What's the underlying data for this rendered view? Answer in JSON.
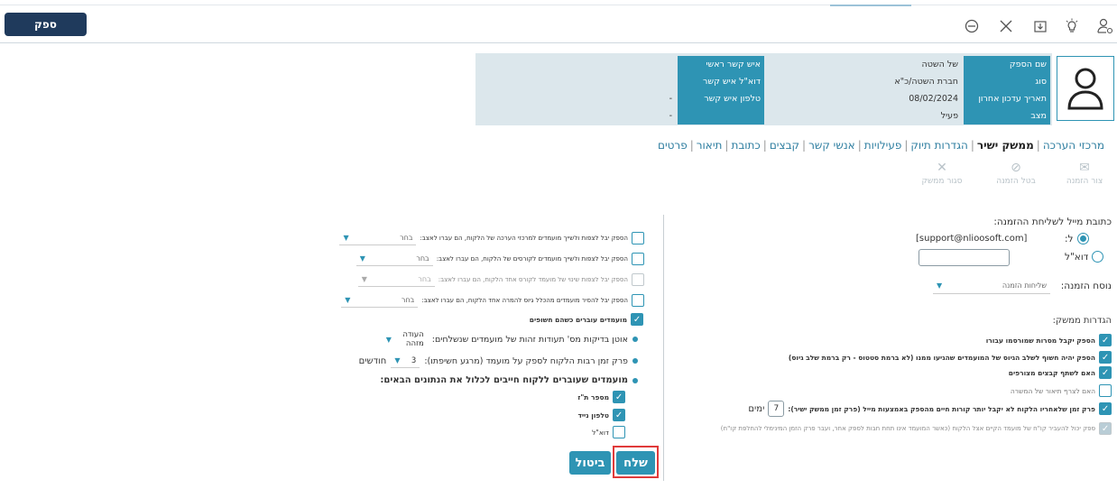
{
  "toolbar": {
    "supplier_button": "ספק",
    "icons": [
      "minus-circle-icon",
      "close-icon",
      "download-icon",
      "lightbulb-icon",
      "user-settings-icon"
    ]
  },
  "info": {
    "rows": [
      {
        "l1": "שם הספק",
        "v1": "של השטה",
        "l2": "איש קשר ראשי",
        "v2": ""
      },
      {
        "l1": "סוג",
        "v1": "חברת השטה/כ\"א",
        "l2": "דוא\"ל איש קשר",
        "v2": ""
      },
      {
        "l1": "תאריך עדכון אחרון",
        "v1": "08/02/2024",
        "l2": "טלפון איש קשר",
        "v2": "-"
      },
      {
        "l1": "מצב",
        "v1": "פעיל",
        "l2": "",
        "v2": "-"
      }
    ]
  },
  "tabs": [
    "פרטים",
    "תיאור",
    "כתובת",
    "קבצים",
    "אנשי קשר",
    "פעילויות",
    "הגדרות תיוק",
    "ממשק ישיר",
    "מרכזי הערכה"
  ],
  "active_tab": "ממשק ישיר",
  "actions": [
    {
      "label": "צור הזמנה",
      "icon": "envelope-icon"
    },
    {
      "label": "בטל הזמנה",
      "icon": "ban-icon"
    },
    {
      "label": "סגור ממשק",
      "icon": "close-icon"
    }
  ],
  "right": {
    "email_title": "כתובת מייל לשליחת ההזמנה:",
    "radio_to": "ל:",
    "email_value": "[support@nlioosoft.com]",
    "radio_email": "דוא\"ל",
    "version_label": "נוסח הזמנה:",
    "version_value": "שליחות הזמנה",
    "settings_title": "הגדרות ממשק:",
    "options": [
      {
        "text": "הספק יקבל מסרות שמורסמו עבורו",
        "checked": true,
        "disabled": false
      },
      {
        "text": "הספק יהיה חשוף לשלב הגיוס של המועמדים שהגיעו ממנו (לא ברמת סטטוס - רק ברמת שלב גיוס)",
        "checked": true,
        "disabled": false
      },
      {
        "text": "האם לשתף קבצים מצורפים",
        "checked": true,
        "disabled": false
      },
      {
        "text": "האם לצרף תיאור של המשרה",
        "checked": false,
        "disabled": false
      },
      {
        "text": "פרק זמן שלאחריו הלקוח לא יקבל יותר קורות חיים מהספק באמצעות מייל (פרק זמן ממשק ישיר):",
        "checked": true,
        "disabled": false,
        "value": "7",
        "unit": "ימים"
      },
      {
        "text": "ספק יכול להעביר קו\"ח של מועמד הקיים אצל הלקוח (כאשר המועמד אינו תחת חבות לספק אחר, ועבר פרק הזמן המינימלי להחלפת קו\"ח)",
        "checked": true,
        "disabled": true
      }
    ]
  },
  "left": {
    "rows": [
      {
        "text": "הספק יבל לצפות ולשייך מועמדים למרכזי הערכה של הלקוח, הם עברו לאצב:",
        "dd": "בחר",
        "checked": false,
        "disabled": false
      },
      {
        "text": "הספק יבל לצפות ולשייך מועמדים לקורסים של הלקוח, הם עברו לאצב:",
        "dd": "בחר",
        "checked": false,
        "disabled": false
      },
      {
        "text": "הספק יבל לצפות שינוי של מועמד לקורס אחד הלקוח, הם עברו לאצב:",
        "dd": "בחר",
        "checked": false,
        "disabled": true
      },
      {
        "text": "הספק יבל להסיר מועמדים מהכלל גיוס להמרה אחד הלקוח, הם עברו לאצב:",
        "dd": "בחר",
        "checked": false,
        "disabled": false
      },
      {
        "text": "מועמדים עוברים כשהם חשופים",
        "checked": true,
        "disabled": false
      }
    ],
    "bullet1": {
      "text": "אוטן בדיקות מס' תעודות זהות של מועמדים שנשלחים:",
      "dd": "העודה מזהה"
    },
    "bullet2": {
      "text": "פרק זמן רבות הלקוח לספק על מועמד (מרגע חשיפתו):",
      "value": "3",
      "unit": "חודשים"
    },
    "bullet3": {
      "text": "מועמדים שעוברים ללקוח חייבים לכלול את הנתונים הבאים:"
    },
    "required": [
      {
        "text": "מספר ת\"ז",
        "checked": true
      },
      {
        "text": "טלפון נייד",
        "checked": true
      },
      {
        "text": "דוא\"ל",
        "checked": false
      }
    ],
    "send_button": "שלח",
    "cancel_button": "ביטול"
  },
  "colors": {
    "accent": "#2e94b4",
    "navy": "#1f3a5c",
    "highlight": "#e03a3a"
  }
}
